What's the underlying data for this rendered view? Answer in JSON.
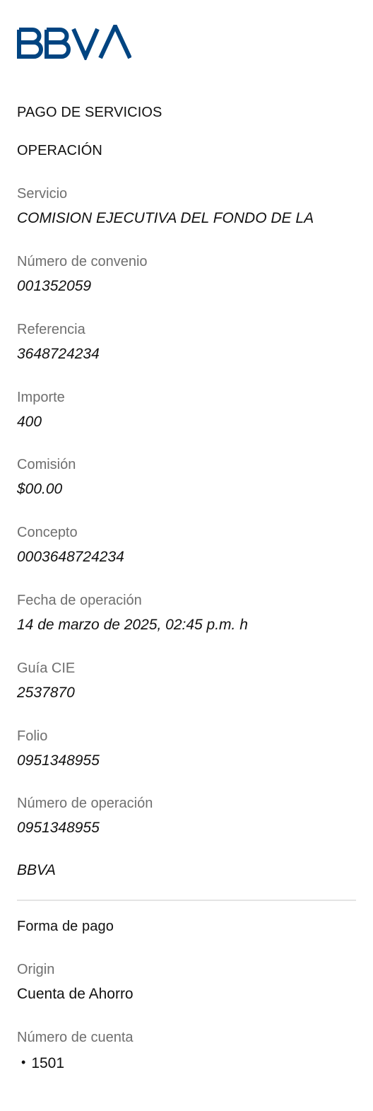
{
  "brand": {
    "logo_text": "BBVA",
    "color": "#004481"
  },
  "header": {
    "title": "PAGO DE SERVICIOS",
    "section": "OPERACIÓN"
  },
  "operation": {
    "fields": [
      {
        "label": "Servicio",
        "value": "COMISION EJECUTIVA DEL FONDO DE LA"
      },
      {
        "label": "Número de convenio",
        "value": "001352059"
      },
      {
        "label": "Referencia",
        "value": "3648724234"
      },
      {
        "label": "Importe",
        "value": "400"
      },
      {
        "label": "Comisión",
        "value": "$00.00"
      },
      {
        "label": "Concepto",
        "value": "0003648724234"
      },
      {
        "label": "Fecha de operación",
        "value": "14 de marzo de 2025, 02:45 p.m. h"
      },
      {
        "label": "Guía CIE",
        "value": "2537870"
      },
      {
        "label": "Folio",
        "value": "0951348955"
      },
      {
        "label": "Número de operación",
        "value": "0951348955"
      }
    ],
    "bank_name": "BBVA"
  },
  "payment": {
    "title": "Forma de pago",
    "fields": [
      {
        "label": "Origin",
        "value": "Cuenta de Ahorro"
      },
      {
        "label": "Número de cuenta",
        "bullet": "•",
        "value": "1501"
      }
    ]
  }
}
